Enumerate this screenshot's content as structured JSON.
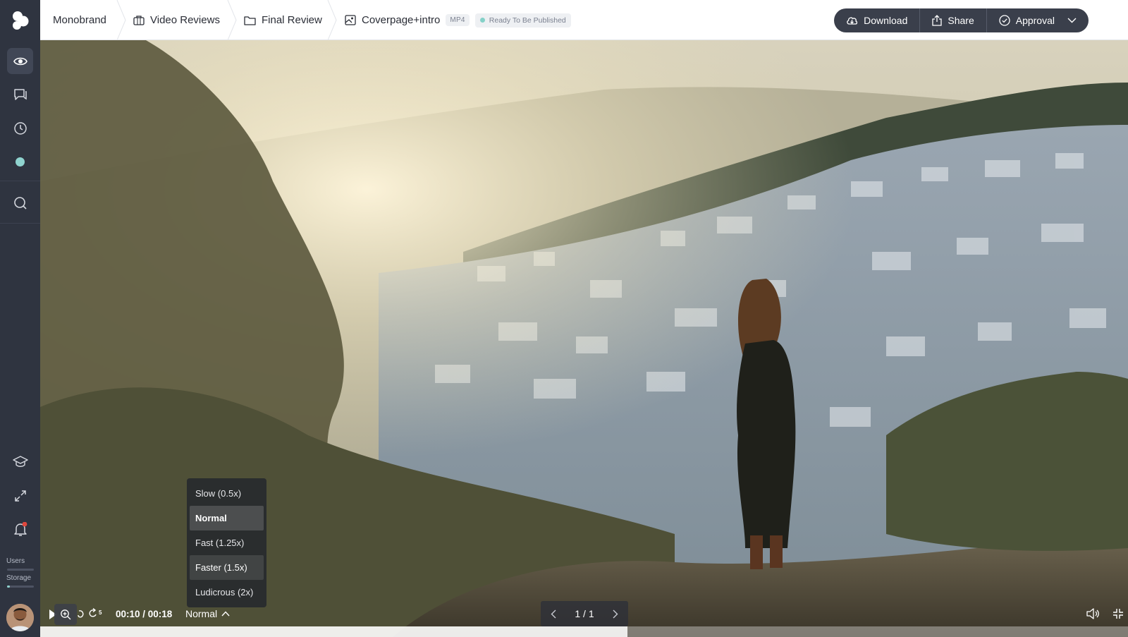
{
  "breadcrumb": {
    "workspace": "Monobrand",
    "project": "Video Reviews",
    "folder": "Final Review",
    "asset": "Coverpage+intro",
    "format": "MP4",
    "status": "Ready To Be Published"
  },
  "actions": {
    "download": "Download",
    "share": "Share",
    "approval": "Approval"
  },
  "sidebar": {
    "users_label": "Users",
    "storage_label": "Storage",
    "users_fraction": 0.0,
    "storage_fraction": 0.1
  },
  "player": {
    "time": "00:10 / 00:18",
    "speed_selected": "Normal",
    "speed_options": [
      "Slow (0.5x)",
      "Normal",
      "Fast (1.25x)",
      "Faster (1.5x)",
      "Ludicrous (2x)"
    ],
    "page_indicator": "1 / 1",
    "skip_seconds": "5",
    "progress_fraction": 0.54
  },
  "colors": {
    "rail_bg": "#2f3440",
    "status_dot": "#84d1c8",
    "action_bar": "#3a3f4b"
  },
  "icons": [
    "app-logo-icon",
    "eye-icon",
    "comments-icon",
    "clock-icon",
    "status-dot-icon",
    "search-icon",
    "graduation-cap-icon",
    "expand-icon",
    "bell-icon",
    "briefcase-icon",
    "folder-icon",
    "image-icon",
    "cloud-download-icon",
    "share-icon",
    "check-circle-icon",
    "chevron-down-icon",
    "play-icon",
    "zoom-in-icon",
    "rewind-5-icon",
    "forward-5-icon",
    "chevron-up-icon",
    "chevron-left-icon",
    "chevron-right-icon",
    "volume-icon",
    "exit-fullscreen-icon"
  ]
}
